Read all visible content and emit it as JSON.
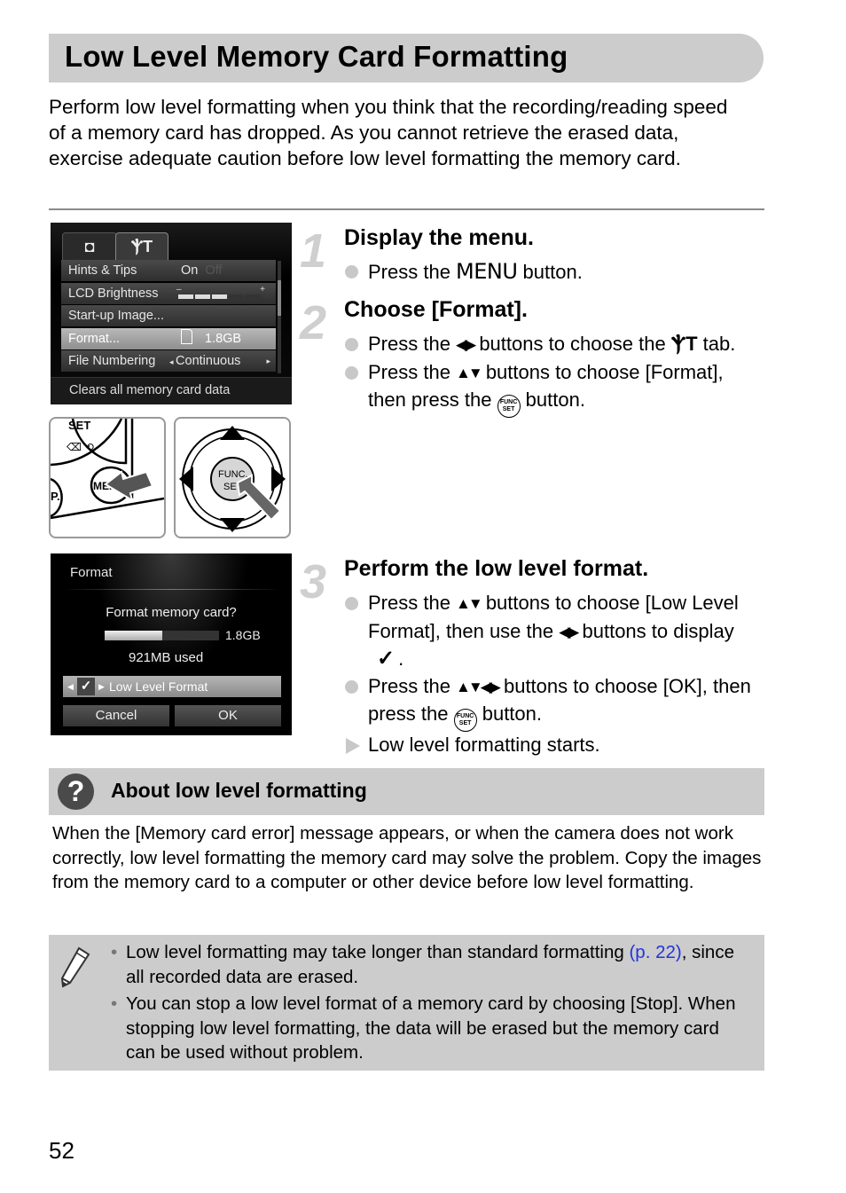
{
  "title": "Low Level Memory Card Formatting",
  "intro": "Perform low level formatting when you think that the recording/reading speed of a memory card has dropped. As you cannot retrieve the erased data, exercise adequate caution before low level formatting the memory card.",
  "screen1": {
    "tabs": [
      {
        "icon": "camera-icon"
      },
      {
        "icon": "tools-icon",
        "selected": true
      }
    ],
    "rows": [
      {
        "label": "Hints & Tips",
        "value": "On",
        "alt": "Off"
      },
      {
        "label": "LCD Brightness",
        "value_level": 3,
        "value_max": 5
      },
      {
        "label": "Start-up Image...",
        "value": ""
      },
      {
        "label": "Format...",
        "value": "1.8GB",
        "selected": true
      },
      {
        "label": "File Numbering",
        "value": "Continuous"
      }
    ],
    "hint": "Clears all memory card data"
  },
  "illustrations": {
    "left": {
      "labels": [
        "SET",
        "MENU",
        "P."
      ]
    },
    "right": {
      "labels": [
        "FUNC.",
        "SET"
      ]
    }
  },
  "steps": [
    {
      "number": "1",
      "title": "Display the menu.",
      "bullets": [
        {
          "pre": "Press the ",
          "token": "MENU",
          "post": " button."
        }
      ]
    },
    {
      "number": "2",
      "title": "Choose [Format].",
      "bullets": [
        {
          "pre": "Press the ",
          "glyph": "◀▶",
          "post": " buttons to choose the ",
          "glyph2": "ⲮT",
          "post2": " tab."
        },
        {
          "pre": "Press the ",
          "glyph": "▲▼",
          "post": " buttons to choose [Format], then press the ",
          "func": "FUNC. SET",
          "post2": " button."
        }
      ]
    },
    {
      "number": "3",
      "title": "Perform the low level format.",
      "bullets": [
        {
          "pre": "Press the ",
          "glyph": "▲▼",
          "post": " buttons to choose [Low Level Format], then use the ",
          "glyph2": "◀▶",
          "post2": " buttons to display ",
          "check": "✓",
          "post3": "."
        },
        {
          "pre": "Press the ",
          "glyph": "▲▼◀▶",
          "post": " buttons to choose [OK], then press the ",
          "func": "FUNC. SET",
          "post2": " button."
        },
        {
          "result": "Low level formatting starts."
        }
      ]
    }
  ],
  "screen2": {
    "header": "Format",
    "question": "Format memory card?",
    "capacity": "1.8GB",
    "used_fraction": 0.5,
    "used": "921MB used",
    "option_checked": "✓",
    "option_label": "Low Level Format",
    "cancel": "Cancel",
    "ok": "OK"
  },
  "about": {
    "title": "About low level formatting",
    "body": "When the [Memory card error] message appears, or when the camera does not work correctly, low level formatting the memory card may solve the problem. Copy the images from the memory card to a computer or other device before low level formatting."
  },
  "notes": [
    {
      "text": "Low level formatting may take longer than standard formatting ",
      "link": "(p. 22)",
      "tail": ", since all recorded data are erased."
    },
    {
      "text": "You can stop a low level format of a memory card by choosing [Stop]. When stopping low level formatting, the data will be erased but the memory card can be used without problem."
    }
  ],
  "page_number": "52",
  "colors": {
    "panel": "#cccccc",
    "link": "#2233dd",
    "step_number": "#cfcfcf"
  }
}
